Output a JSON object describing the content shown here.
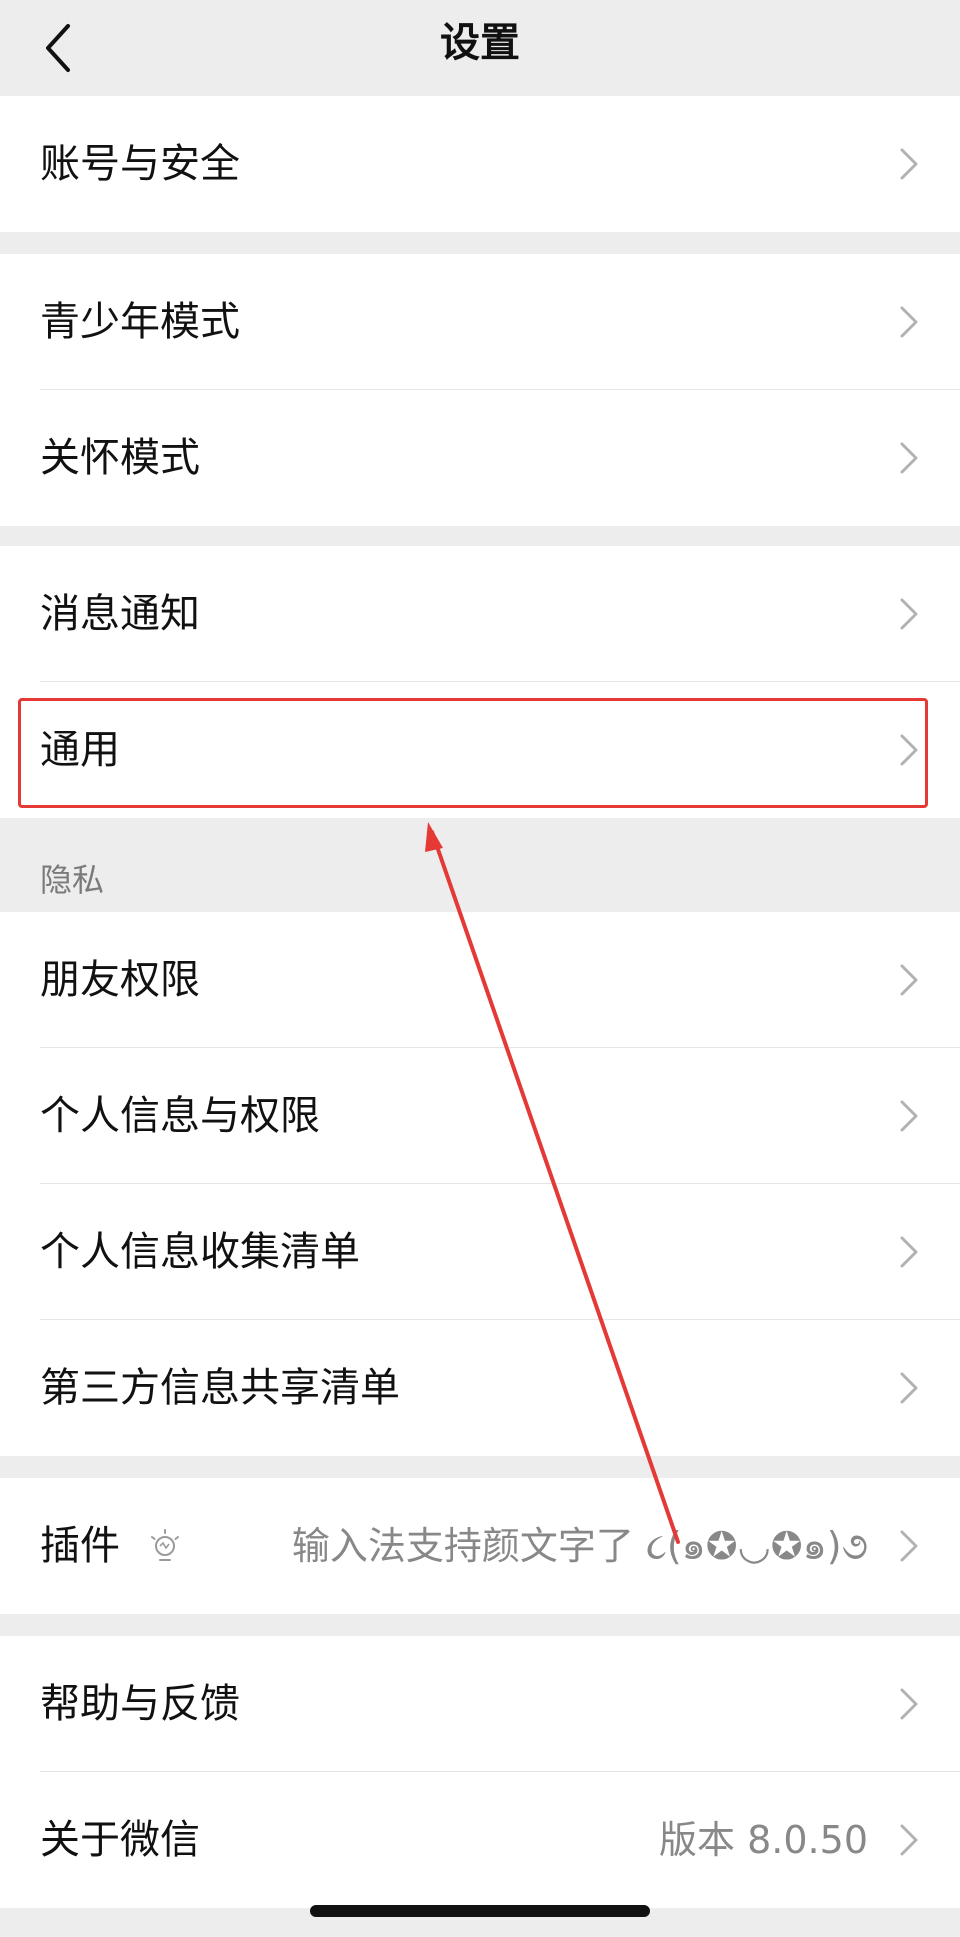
{
  "nav": {
    "title": "设置",
    "back_icon": "chevron-left-icon"
  },
  "groups": [
    {
      "items": [
        {
          "label": "账号与安全"
        }
      ]
    },
    {
      "items": [
        {
          "label": "青少年模式"
        },
        {
          "label": "关怀模式"
        }
      ]
    },
    {
      "items": [
        {
          "label": "消息通知"
        },
        {
          "label": "通用"
        }
      ]
    }
  ],
  "privacy": {
    "section_label": "隐私",
    "items": [
      {
        "label": "朋友权限"
      },
      {
        "label": "个人信息与权限"
      },
      {
        "label": "个人信息收集清单"
      },
      {
        "label": "第三方信息共享清单"
      }
    ]
  },
  "plugins": {
    "label": "插件",
    "icon": "bulb-icon",
    "value": "输入法支持颜文字了 ૮(๑✪◡✪๑)૭"
  },
  "help": {
    "label": "帮助与反馈"
  },
  "about": {
    "label": "关于微信",
    "value": "版本 8.0.50"
  },
  "annotation_color": "#e53935"
}
